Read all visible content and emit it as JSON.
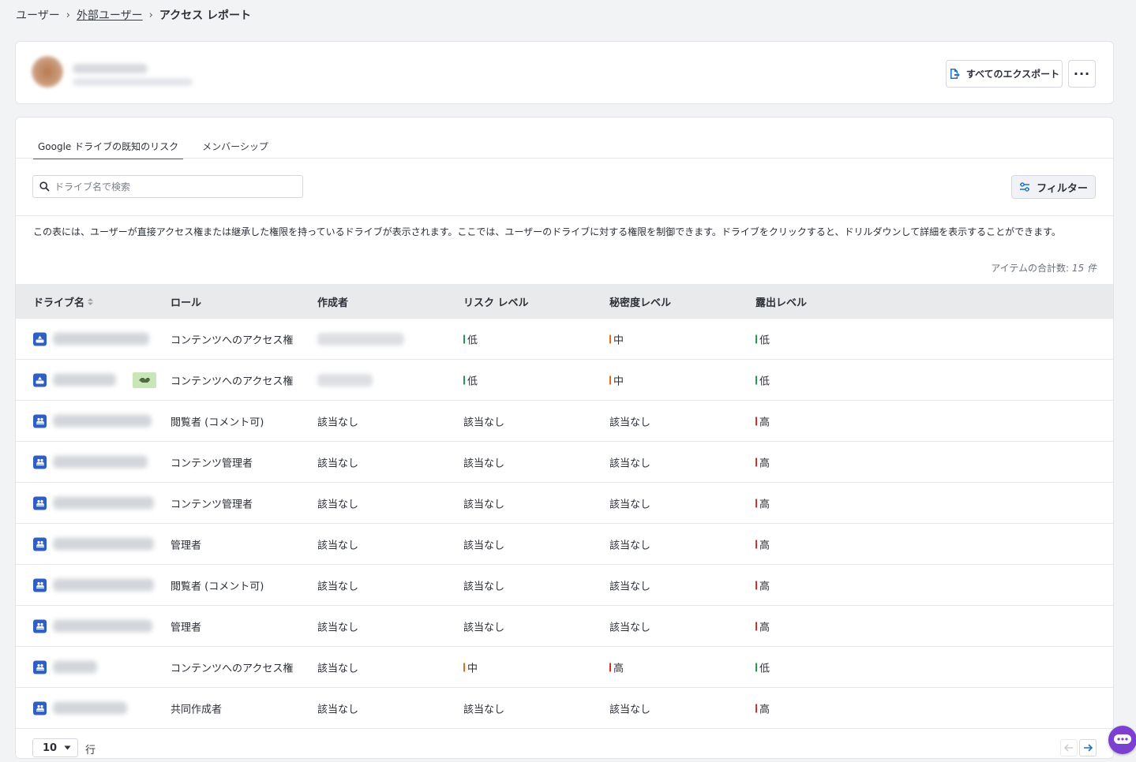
{
  "breadcrumb": {
    "root": "ユーザー",
    "parent": "外部ユーザー",
    "current": "アクセス レポート"
  },
  "header": {
    "export_label": "すべてのエクスポート",
    "more_label": "···"
  },
  "tabs": [
    {
      "label": "Google ドライブの既知のリスク",
      "active": true
    },
    {
      "label": "メンバーシップ",
      "active": false
    }
  ],
  "search": {
    "placeholder": "ドライブ名で検索",
    "value": ""
  },
  "filter": {
    "label": "フィルター"
  },
  "description": "この表には、ユーザーが直接アクセス権または継承した権限を持っているドライブが表示されます。ここでは、ユーザーのドライブに対する権限を制御できます。ドライブをクリックすると、ドリルダウンして詳細を表示することができます。",
  "total": {
    "label": "アイテムの合計数:",
    "value": "15 件"
  },
  "columns": {
    "name": "ドライブ名",
    "role": "ロール",
    "creator": "作成者",
    "risk": "リスク レベル",
    "secrecy": "秘密度レベル",
    "exposure": "露出レベル"
  },
  "level_colors": {
    "低": "#1e9e4a",
    "中": "#e06a1b",
    "高": "#d32f2f"
  },
  "rows": [
    {
      "icon": "shared-drive-icon",
      "role": "コンテンツへのアクセス権",
      "creator": "",
      "risk": "低",
      "secrecy": "中",
      "exposure": "低"
    },
    {
      "icon": "shared-drive-icon",
      "role": "コンテンツへのアクセス権",
      "creator": "",
      "risk": "低",
      "secrecy": "中",
      "exposure": "低",
      "external_badge": true
    },
    {
      "icon": "group-drive-icon",
      "role": "閲覧者 (コメント可)",
      "creator": "該当なし",
      "risk": "該当なし",
      "secrecy": "該当なし",
      "exposure": "高"
    },
    {
      "icon": "group-drive-icon",
      "role": "コンテンツ管理者",
      "creator": "該当なし",
      "risk": "該当なし",
      "secrecy": "該当なし",
      "exposure": "高"
    },
    {
      "icon": "group-drive-icon",
      "role": "コンテンツ管理者",
      "creator": "該当なし",
      "risk": "該当なし",
      "secrecy": "該当なし",
      "exposure": "高"
    },
    {
      "icon": "group-drive-icon",
      "role": "管理者",
      "creator": "該当なし",
      "risk": "該当なし",
      "secrecy": "該当なし",
      "exposure": "高"
    },
    {
      "icon": "group-drive-icon",
      "role": "閲覧者 (コメント可)",
      "creator": "該当なし",
      "risk": "該当なし",
      "secrecy": "該当なし",
      "exposure": "高"
    },
    {
      "icon": "group-drive-icon",
      "role": "管理者",
      "creator": "該当なし",
      "risk": "該当なし",
      "secrecy": "該当なし",
      "exposure": "高"
    },
    {
      "icon": "group-drive-icon",
      "role": "コンテンツへのアクセス権",
      "creator": "該当なし",
      "risk": "中",
      "secrecy": "高",
      "exposure": "低"
    },
    {
      "icon": "group-drive-icon",
      "role": "共同作成者",
      "creator": "該当なし",
      "risk": "該当なし",
      "secrecy": "該当なし",
      "exposure": "高"
    }
  ],
  "pagination": {
    "page_size": "10",
    "rows_label": "行"
  }
}
